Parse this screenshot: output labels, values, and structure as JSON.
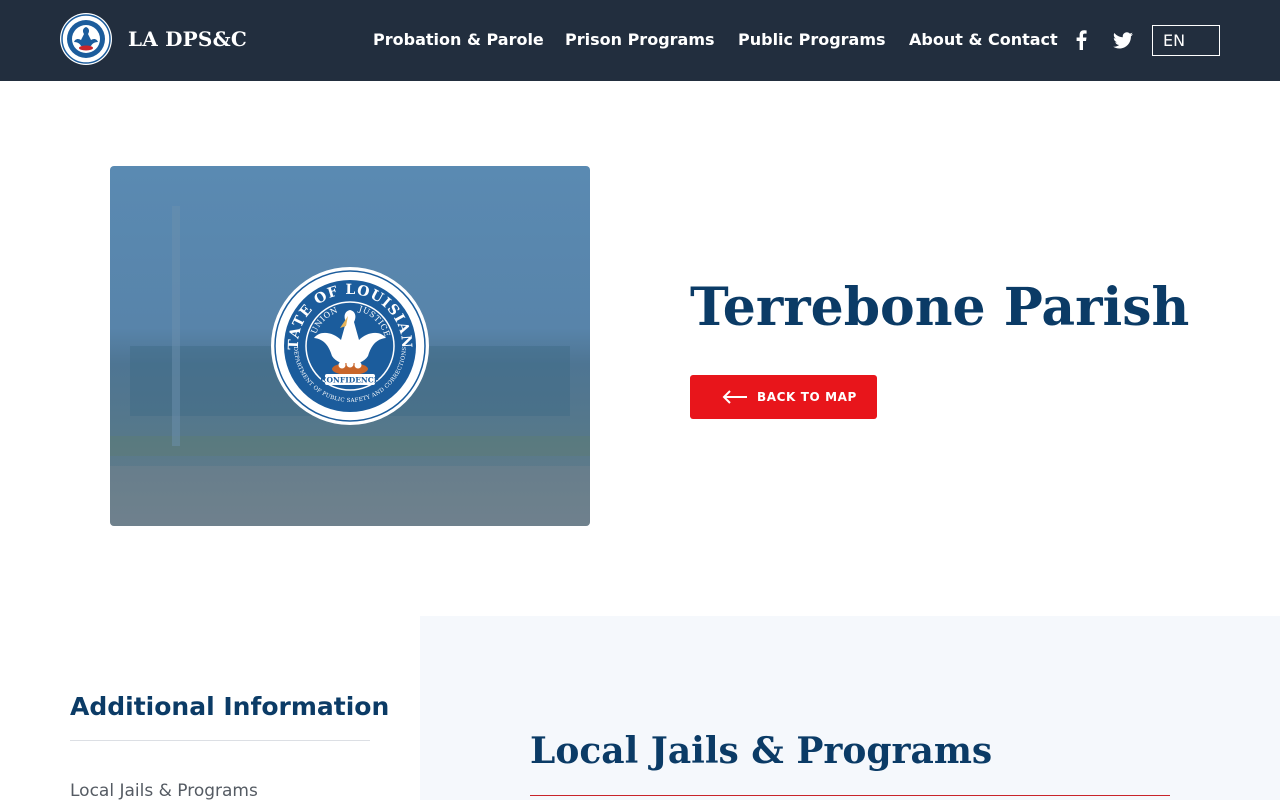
{
  "header": {
    "brand_name": "LA DPS&C",
    "nav": [
      "Probation & Parole",
      "Prison Programs",
      "Public Programs",
      "About & Contact"
    ],
    "social": [
      "facebook-icon",
      "twitter-icon"
    ],
    "language": "EN"
  },
  "hero": {
    "title": "Terrebone Parish",
    "back_button": "BACK TO MAP",
    "image_seal": {
      "top_text": "STATE OF LOUISIANA",
      "inner_left": "UNION",
      "inner_right": "JUSTICE",
      "bottom_text": "CONFIDENCE",
      "ring_text": "DEPARTMENT OF PUBLIC SAFETY AND CORRECTIONS"
    }
  },
  "sidebar": {
    "heading": "Additional Information",
    "links": [
      "Local Jails & Programs"
    ]
  },
  "main": {
    "heading": "Local Jails & Programs"
  },
  "colors": {
    "navbar": "#222e3e",
    "navy_text": "#0b3b66",
    "button_red": "#e8151b",
    "panel_bg": "#f5f8fc"
  }
}
